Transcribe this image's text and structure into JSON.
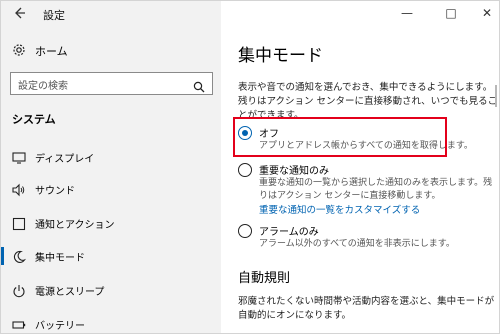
{
  "window": {
    "title": "設定",
    "back_icon": "back-arrow-icon",
    "controls": {
      "minimize": "—",
      "maximize": "□",
      "close": "✕"
    }
  },
  "sidebar": {
    "home_label": "ホーム",
    "search_placeholder": "設定の検索",
    "section_title": "システム",
    "items": [
      {
        "label": "ディスプレイ",
        "icon": "display-icon",
        "selected": false
      },
      {
        "label": "サウンド",
        "icon": "speaker-icon",
        "selected": false
      },
      {
        "label": "通知とアクション",
        "icon": "notification-icon",
        "selected": false
      },
      {
        "label": "集中モード",
        "icon": "moon-icon",
        "selected": true
      },
      {
        "label": "電源とスリープ",
        "icon": "power-icon",
        "selected": false
      },
      {
        "label": "バッテリー",
        "icon": "battery-icon",
        "selected": false
      }
    ]
  },
  "main": {
    "title": "集中モード",
    "description": "表示や音での通知を選んでおき、集中できるようにします。残りはアクション センターに直接移動され、いつでも見ることができます。",
    "options": [
      {
        "label": "オフ",
        "sub": "アプリとアドレス帳からすべての通知を取得します。",
        "checked": true
      },
      {
        "label": "重要な通知のみ",
        "sub": "重要な通知の一覧から選択した通知のみを表示します。残りはアクション センターに直接移動します。",
        "link": "重要な通知の一覧をカスタマイズする",
        "checked": false
      },
      {
        "label": "アラームのみ",
        "sub": "アラーム以外のすべての通知を非表示にします。",
        "checked": false
      }
    ],
    "auto_rules_title": "自動規則",
    "auto_rules_description": "邪魔されたくない時間帯や活動内容を選ぶと、集中モードが自動的にオンになります。"
  },
  "colors": {
    "accent": "#0063b1",
    "highlight": "#e3001b",
    "sidebar_bg": "#f2f2f2"
  }
}
